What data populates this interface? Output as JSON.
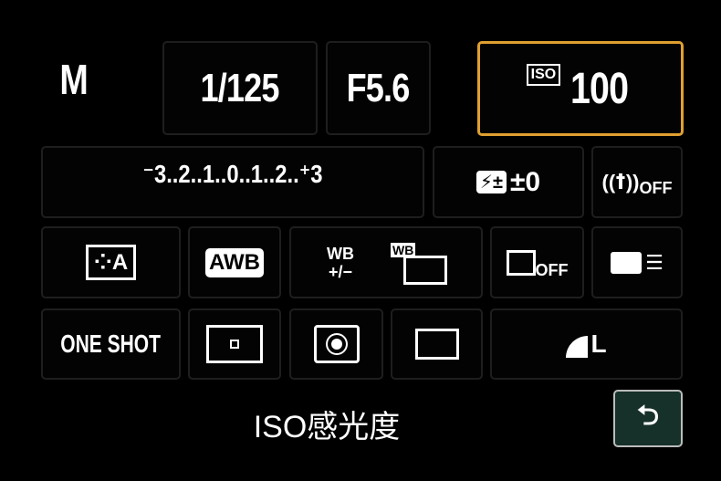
{
  "shooting_mode": "M",
  "shutter_speed": "1/125",
  "aperture": "F5.6",
  "iso": {
    "badge": "ISO",
    "value": "100"
  },
  "exposure_scale": "⁻3..2..1..0..1..2..⁺3",
  "flash_compensation": "±0",
  "wireless_flash": "OFF",
  "picture_style": "A",
  "white_balance": "AWB",
  "wb_shift": {
    "top": "WB",
    "bottom": "+/−"
  },
  "wb_bracket": "WB",
  "face_priority": "OFF",
  "af_mode": "ONE SHOT",
  "image_quality": "L",
  "selected_label": "ISO感光度",
  "accent_color": "#e0a030"
}
